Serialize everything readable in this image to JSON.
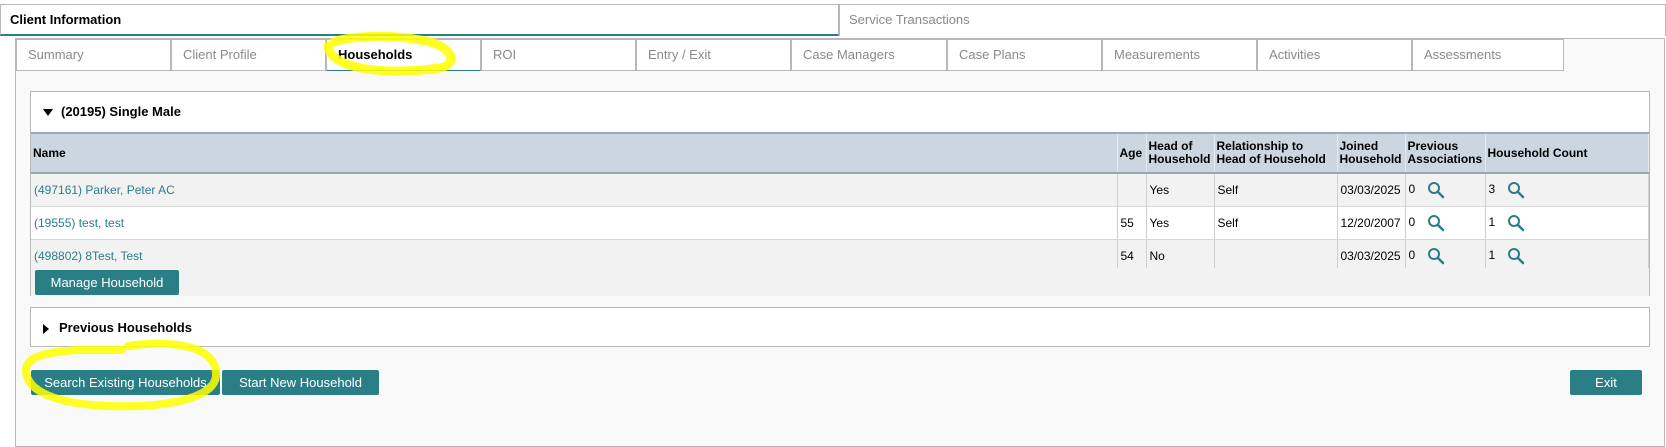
{
  "main_tabs": [
    {
      "label": "Client Information",
      "active": true
    },
    {
      "label": "Service Transactions",
      "active": false
    }
  ],
  "sub_tabs": [
    {
      "label": "Summary"
    },
    {
      "label": "Client Profile"
    },
    {
      "label": "Households",
      "active": true
    },
    {
      "label": "ROI"
    },
    {
      "label": "Entry / Exit"
    },
    {
      "label": "Case Managers"
    },
    {
      "label": "Case Plans"
    },
    {
      "label": "Measurements"
    },
    {
      "label": "Activities"
    },
    {
      "label": "Assessments"
    }
  ],
  "household": {
    "title": "(20195) Single Male",
    "columns": {
      "name": "Name",
      "age": "Age",
      "head": "Head of Household",
      "relationship": "Relationship to Head of Household",
      "joined": "Joined Household",
      "previous": "Previous Associations",
      "count": "Household Count"
    },
    "rows": [
      {
        "name": "(497161) Parker, Peter AC",
        "age": "",
        "head": "Yes",
        "relationship": "Self",
        "joined": "03/03/2025",
        "previous": "0",
        "count": "3"
      },
      {
        "name": "(19555) test, test",
        "age": "55",
        "head": "Yes",
        "relationship": "Self",
        "joined": "12/20/2007",
        "previous": "0",
        "count": "1"
      },
      {
        "name": "(498802) 8Test, Test",
        "age": "54",
        "head": "No",
        "relationship": "",
        "joined": "03/03/2025",
        "previous": "0",
        "count": "1"
      }
    ],
    "manage_button": "Manage Household"
  },
  "previous_households": {
    "title": "Previous Households"
  },
  "buttons": {
    "search_existing": "Search Existing Households",
    "start_new": "Start New Household",
    "exit": "Exit"
  },
  "colors": {
    "accent": "#2a7f87",
    "header_bg": "#ccd6e0",
    "highlight": "#ffff00"
  }
}
